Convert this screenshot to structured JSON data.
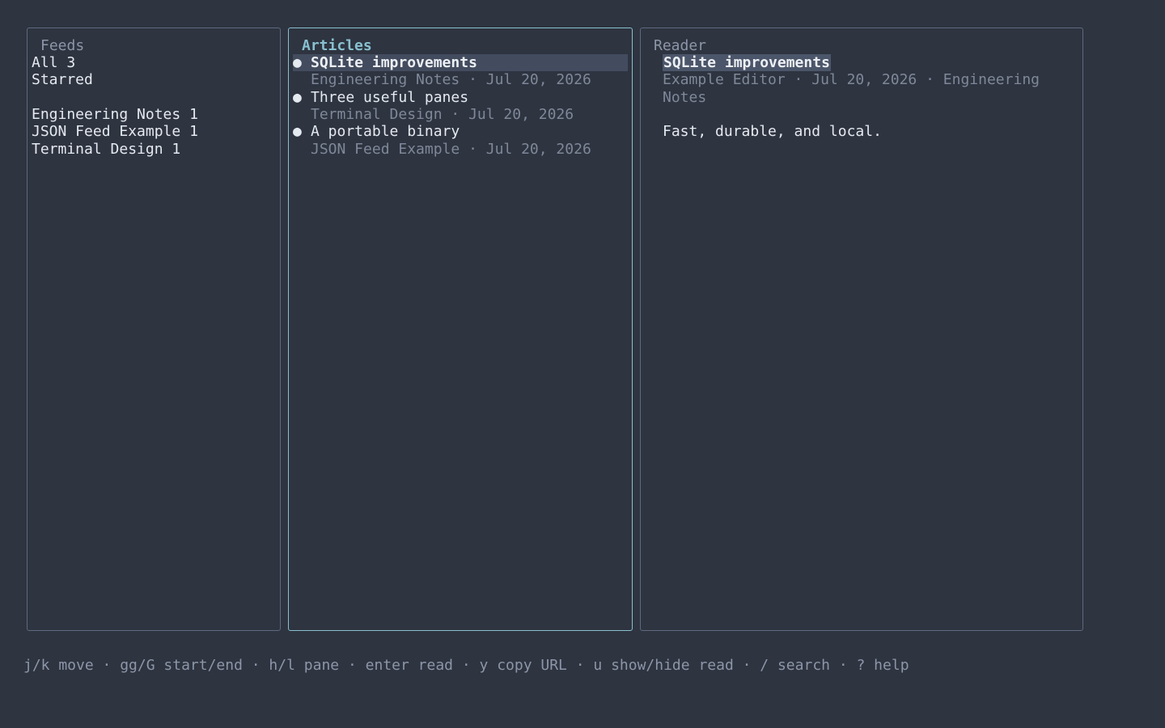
{
  "feeds": {
    "title": "Feeds",
    "items": [
      {
        "label": "All 3"
      },
      {
        "label": "Starred"
      },
      {
        "label": ""
      },
      {
        "label": "Engineering Notes 1"
      },
      {
        "label": "JSON Feed Example 1"
      },
      {
        "label": "Terminal Design 1"
      }
    ]
  },
  "articles": {
    "title": "Articles",
    "items": [
      {
        "bullet": "●",
        "title": "SQLite improvements",
        "meta": "Engineering Notes · Jul 20, 2026",
        "selected": true
      },
      {
        "bullet": "●",
        "title": "Three useful panes",
        "meta": "Terminal Design · Jul 20, 2026",
        "selected": false
      },
      {
        "bullet": "●",
        "title": "A portable binary",
        "meta": "JSON Feed Example · Jul 20, 2026",
        "selected": false
      }
    ]
  },
  "reader": {
    "title": "Reader",
    "article_title": "SQLite improvements",
    "meta": "Example Editor · Jul 20, 2026 · Engineering Notes",
    "body": "Fast, durable, and local."
  },
  "status": {
    "text": "j/k move · gg/G start/end · h/l pane · enter read · y copy URL · u show/hide read · / search · ? help"
  },
  "colors": {
    "background": "#2e3440",
    "active_border": "#88c0d0",
    "inactive_border": "#5e6a80",
    "selection": "#434c5e",
    "muted_text": "#7f8899"
  }
}
